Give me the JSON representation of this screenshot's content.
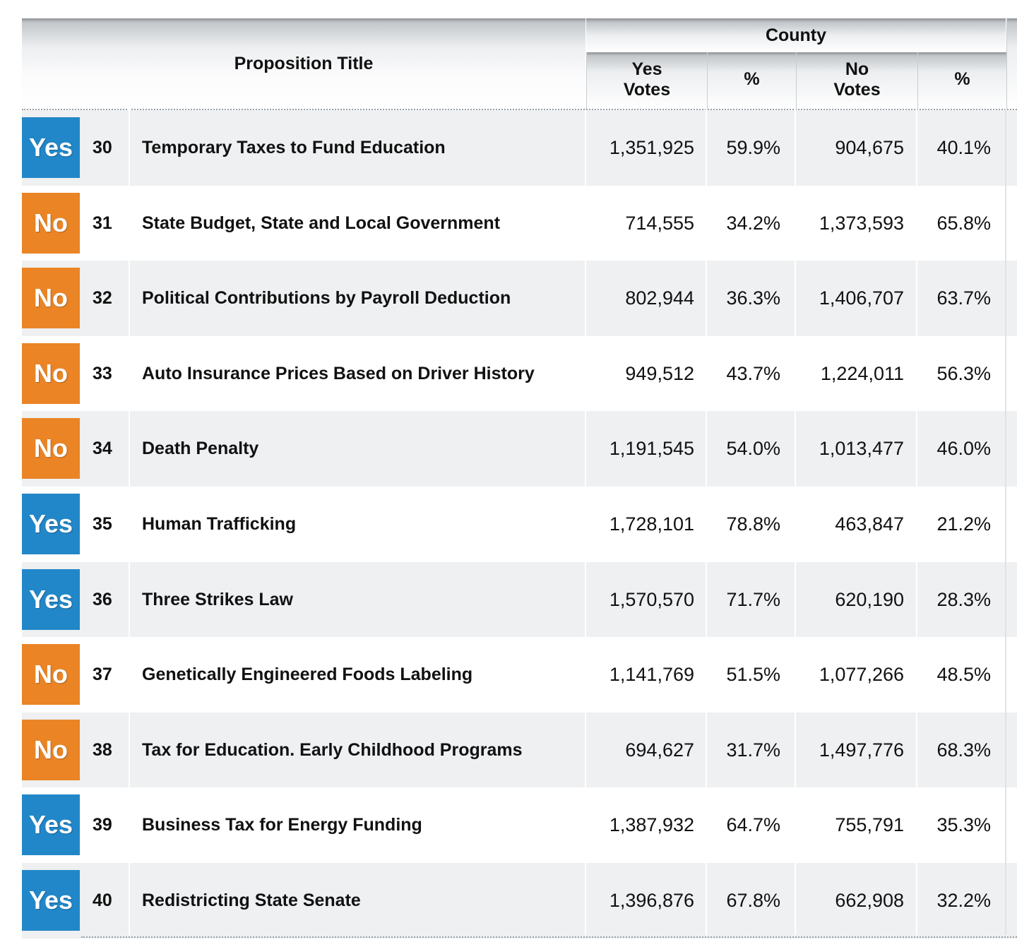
{
  "header": {
    "proposition_title": "Proposition Title",
    "county": "County",
    "yes_votes_line1": "Yes",
    "yes_votes_line2": "Votes",
    "pct": "%",
    "no_votes_line1": "No",
    "no_votes_line2": "Votes"
  },
  "colors": {
    "yes": "#2187c8",
    "no": "#ea8425"
  },
  "rows": [
    {
      "result": "Yes",
      "number": "30",
      "title": "Temporary Taxes to Fund Education",
      "yes_votes": "1,351,925",
      "yes_pct": "59.9%",
      "no_votes": "904,675",
      "no_pct": "40.1%"
    },
    {
      "result": "No",
      "number": "31",
      "title": "State Budget, State and Local Government",
      "yes_votes": "714,555",
      "yes_pct": "34.2%",
      "no_votes": "1,373,593",
      "no_pct": "65.8%"
    },
    {
      "result": "No",
      "number": "32",
      "title": "Political Contributions by Payroll Deduction",
      "yes_votes": "802,944",
      "yes_pct": "36.3%",
      "no_votes": "1,406,707",
      "no_pct": "63.7%"
    },
    {
      "result": "No",
      "number": "33",
      "title": "Auto Insurance Prices Based on Driver History",
      "yes_votes": "949,512",
      "yes_pct": "43.7%",
      "no_votes": "1,224,011",
      "no_pct": "56.3%"
    },
    {
      "result": "No",
      "number": "34",
      "title": "Death Penalty",
      "yes_votes": "1,191,545",
      "yes_pct": "54.0%",
      "no_votes": "1,013,477",
      "no_pct": "46.0%"
    },
    {
      "result": "Yes",
      "number": "35",
      "title": "Human Trafficking",
      "yes_votes": "1,728,101",
      "yes_pct": "78.8%",
      "no_votes": "463,847",
      "no_pct": "21.2%"
    },
    {
      "result": "Yes",
      "number": "36",
      "title": "Three Strikes Law",
      "yes_votes": "1,570,570",
      "yes_pct": "71.7%",
      "no_votes": "620,190",
      "no_pct": "28.3%"
    },
    {
      "result": "No",
      "number": "37",
      "title": "Genetically Engineered Foods Labeling",
      "yes_votes": "1,141,769",
      "yes_pct": "51.5%",
      "no_votes": "1,077,266",
      "no_pct": "48.5%"
    },
    {
      "result": "No",
      "number": "38",
      "title": "Tax for Education. Early Childhood Programs",
      "yes_votes": "694,627",
      "yes_pct": "31.7%",
      "no_votes": "1,497,776",
      "no_pct": "68.3%"
    },
    {
      "result": "Yes",
      "number": "39",
      "title": "Business Tax for Energy Funding",
      "yes_votes": "1,387,932",
      "yes_pct": "64.7%",
      "no_votes": "755,791",
      "no_pct": "35.3%"
    },
    {
      "result": "Yes",
      "number": "40",
      "title": "Redistricting State Senate",
      "yes_votes": "1,396,876",
      "yes_pct": "67.8%",
      "no_votes": "662,908",
      "no_pct": "32.2%"
    }
  ]
}
